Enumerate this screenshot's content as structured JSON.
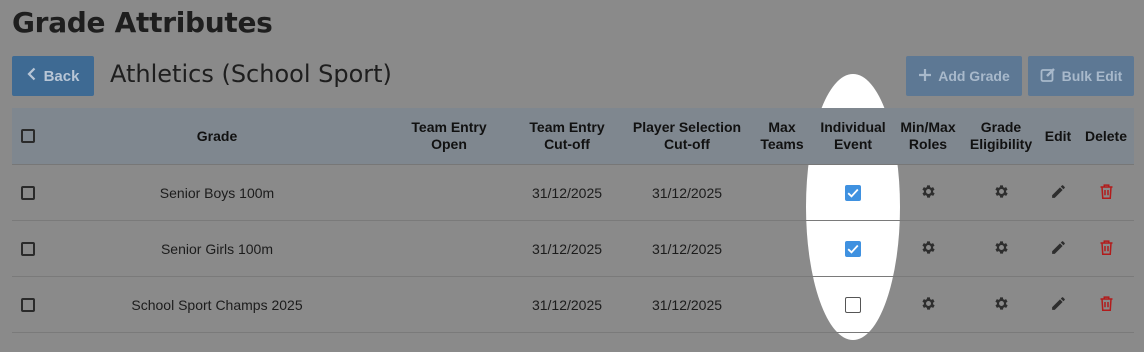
{
  "page": {
    "title": "Grade Attributes",
    "subtitle": "Athletics (School Sport)"
  },
  "toolbar": {
    "back_label": "Back",
    "add_label": "Add Grade",
    "bulk_label": "Bulk Edit"
  },
  "table": {
    "headers": {
      "grade": "Grade",
      "team_entry_open": [
        "Team Entry",
        "Open"
      ],
      "team_entry_cutoff": [
        "Team Entry",
        "Cut-off"
      ],
      "player_selection_cutoff": [
        "Player Selection",
        "Cut-off"
      ],
      "max_teams": [
        "Max",
        "Teams"
      ],
      "individual_event": [
        "Individual",
        "Event"
      ],
      "min_max_roles": [
        "Min/Max",
        "Roles"
      ],
      "grade_eligibility": [
        "Grade",
        "Eligibility"
      ],
      "edit": "Edit",
      "delete": "Delete"
    },
    "rows": [
      {
        "grade": "Senior Boys 100m",
        "team_entry_open": "",
        "team_entry_cutoff": "31/12/2025",
        "player_selection_cutoff": "31/12/2025",
        "max_teams": "",
        "individual_event": true
      },
      {
        "grade": "Senior Girls 100m",
        "team_entry_open": "",
        "team_entry_cutoff": "31/12/2025",
        "player_selection_cutoff": "31/12/2025",
        "max_teams": "",
        "individual_event": true
      },
      {
        "grade": "School Sport Champs 2025",
        "team_entry_open": "",
        "team_entry_cutoff": "31/12/2025",
        "player_selection_cutoff": "31/12/2025",
        "max_teams": "",
        "individual_event": false
      }
    ]
  },
  "icons": {
    "back": "chevron-left-icon",
    "add": "plus-icon",
    "bulk": "edit-square-icon",
    "roles": "gear-icon",
    "eligibility": "gear-icon",
    "edit": "pencil-icon",
    "delete": "trash-icon"
  },
  "colors": {
    "primary_button": "#3e6a93",
    "disabled_button": "#5d7894",
    "checkbox_checked": "#3f91e0",
    "delete_icon": "#b21b1b"
  }
}
